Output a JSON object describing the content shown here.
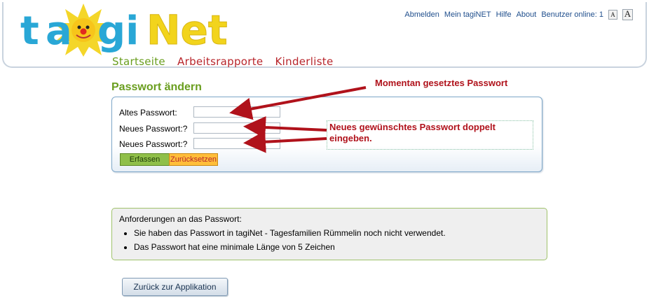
{
  "header": {
    "logo_text": "tagiNet",
    "top_links": [
      "Abmelden",
      "Mein tagiNET",
      "Hilfe",
      "About"
    ],
    "users_online": "Benutzer online: 1",
    "font_small": "A",
    "font_large": "A"
  },
  "main_nav": {
    "start": "Startseite",
    "reports": "Arbeitsrapporte",
    "children": "Kinderliste"
  },
  "page": {
    "title": "Passwort ändern"
  },
  "form": {
    "old_label": "Altes Passwort:",
    "new_label": "Neues Passwort:?",
    "repeat_label": "Neues Passwort:?",
    "old_value": "",
    "new_value": "",
    "repeat_value": "",
    "submit_label": "Erfassen",
    "reset_label": "Zurücksetzen"
  },
  "annotations": {
    "current": "Momentan gesetztes Passwort",
    "new": "Neues gewünschtes Passwort doppelt eingeben."
  },
  "requirements": {
    "title": "Anforderungen an das Passwort:",
    "items": [
      "Sie haben das Passwort in tagiNet - Tagesfamilien Rümmelin noch nicht verwendet.",
      "Das Passwort hat eine minimale Länge von 5 Zeichen"
    ]
  },
  "back_button": "Zurück zur Applikation",
  "colors": {
    "brand_green": "#6a9e1f",
    "brand_red": "#b8252b",
    "annotation_red": "#b0121b",
    "link_blue": "#1f4e8c"
  }
}
